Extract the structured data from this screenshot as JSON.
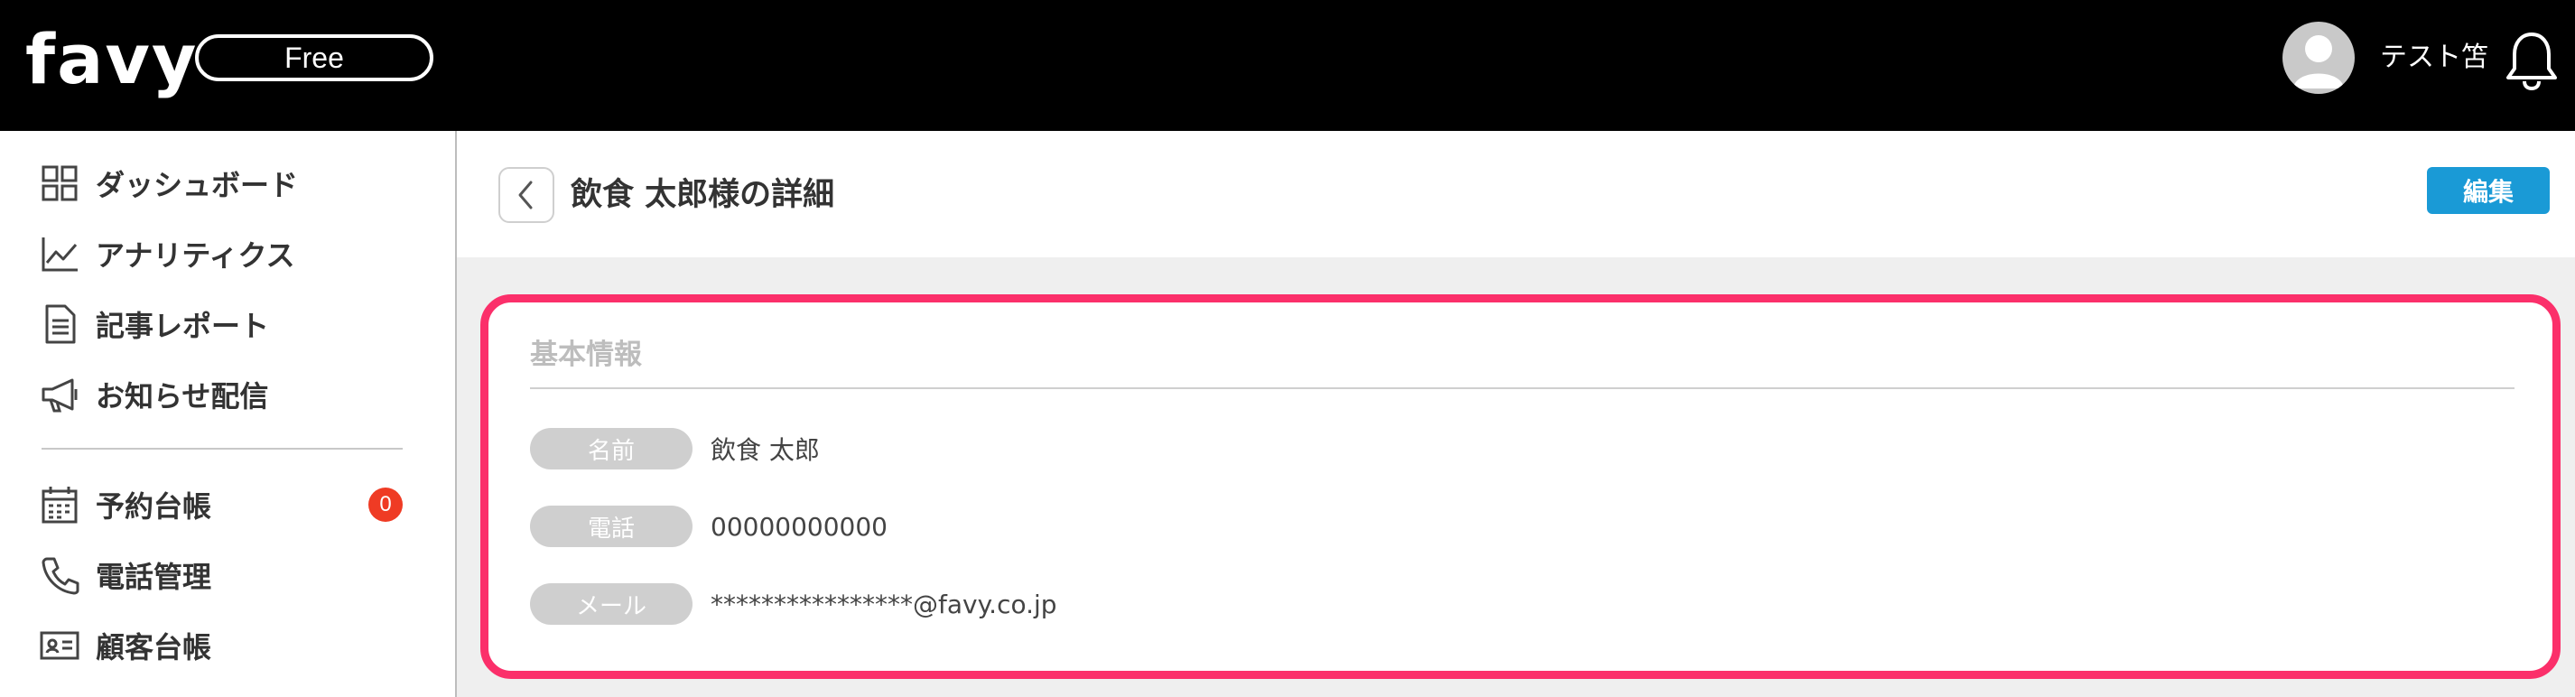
{
  "header": {
    "logo_text": "favy",
    "plan_label": "Free",
    "username": "テスト笘"
  },
  "sidebar": {
    "items": [
      {
        "label": "ダッシュボード",
        "icon": "grid-icon"
      },
      {
        "label": "アナリティクス",
        "icon": "line-chart-icon"
      },
      {
        "label": "記事レポート",
        "icon": "document-icon"
      },
      {
        "label": "お知らせ配信",
        "icon": "megaphone-icon"
      }
    ],
    "items_secondary": [
      {
        "label": "予約台帳",
        "icon": "calendar-icon",
        "badge": "0"
      },
      {
        "label": "電話管理",
        "icon": "phone-icon"
      },
      {
        "label": "顧客台帳",
        "icon": "id-card-icon"
      }
    ]
  },
  "page": {
    "title": "飲食 太郎様の詳細",
    "edit_label": "編集"
  },
  "card": {
    "title": "基本情報",
    "fields": [
      {
        "label": "名前",
        "value": "飲食 太郎"
      },
      {
        "label": "電話",
        "value": "00000000000"
      },
      {
        "label": "メール",
        "value": "****************@favy.co.jp"
      }
    ]
  },
  "colors": {
    "header_bg": "#000000",
    "accent_border": "#fb2f6a",
    "edit_button": "#1a9ad6",
    "badge": "#ef3b24"
  }
}
